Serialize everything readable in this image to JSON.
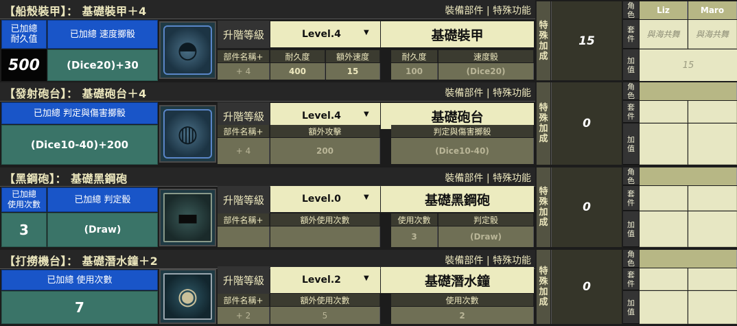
{
  "sections": [
    {
      "title": "【船殼裝甲】： 基礎裝甲＋4",
      "func": "裝備部件 | 特殊功能",
      "left_label_a": "已加總\n耐久值",
      "left_label_b": "已加總 速度擲骰",
      "left_value_a": "500",
      "left_value_b": "(Dice20)+30",
      "icon": "hull-armor-icon",
      "upgrade_label": "升階等級",
      "level": "Level.4",
      "part_name": "基礎裝甲",
      "headers": [
        "部件名稱+",
        "耐久度",
        "額外速度",
        "耐久度",
        "速度骰"
      ],
      "values": [
        "+ 4",
        "400",
        "15",
        "100",
        "(Dice20)"
      ],
      "special_label": "特\n殊\n加\n成",
      "special_value": "15",
      "role_label": "角\n色",
      "set_label": "套\n件",
      "bonus_label": "加\n值",
      "players": [
        "Liz",
        "Maro"
      ],
      "sets": [
        "與海共舞",
        "與海共舞"
      ],
      "bonus": "15"
    },
    {
      "title": "【發射砲台】： 基礎砲台＋4",
      "func": "裝備部件 | 特殊功能",
      "left_label_b": "已加總 判定與傷害擲骰",
      "left_value_b": "(Dice10-40)+200",
      "icon": "cannon-turret-icon",
      "upgrade_label": "升階等級",
      "level": "Level.4",
      "part_name": "基礎砲台",
      "headers": [
        "部件名稱+",
        "額外攻擊",
        "判定與傷害擲骰"
      ],
      "values": [
        "+ 4",
        "200",
        "(Dice10-40)"
      ],
      "special_label": "特\n殊\n加\n成",
      "special_value": "0",
      "role_label": "角\n色",
      "set_label": "套\n件",
      "bonus_label": "加\n值"
    },
    {
      "title": "【黑鋼砲】： 基礎黑鋼砲",
      "func": "裝備部件 | 特殊功能",
      "left_label_a": "已加總\n使用次數",
      "left_label_b": "已加總 判定骰",
      "left_value_a": "3",
      "left_value_b": "(Draw)",
      "icon": "black-steel-cannon-icon",
      "upgrade_label": "升階等級",
      "level": "Level.0",
      "part_name": "基礎黑鋼砲",
      "headers": [
        "部件名稱+",
        "額外使用次數",
        "使用次數",
        "判定骰"
      ],
      "values": [
        "",
        "",
        "3",
        "(Draw)"
      ],
      "special_label": "特\n殊\n加\n成",
      "special_value": "0",
      "role_label": "角\n色",
      "set_label": "套\n件",
      "bonus_label": "加\n值"
    },
    {
      "title": "【打撈機台】： 基礎潛水鐘＋2",
      "func": "裝備部件 | 特殊功能",
      "left_label_b": "已加總 使用次數",
      "left_value_b": "7",
      "icon": "diving-bell-icon",
      "upgrade_label": "升階等級",
      "level": "Level.2",
      "part_name": "基礎潛水鐘",
      "headers": [
        "部件名稱+",
        "額外使用次數",
        "使用次數"
      ],
      "values": [
        "+ 2",
        "5",
        "2"
      ],
      "special_label": "特\n殊\n加\n成",
      "special_value": "0",
      "role_label": "角\n色",
      "set_label": "套\n件",
      "bonus_label": "加\n值"
    }
  ],
  "colors": {
    "header_bg": "#262626",
    "title_text": "#ece7bd",
    "blue": "#1955c8",
    "teal": "#3a7468",
    "cream": "#ecebbf",
    "olive_cell": "#6f6f55"
  }
}
